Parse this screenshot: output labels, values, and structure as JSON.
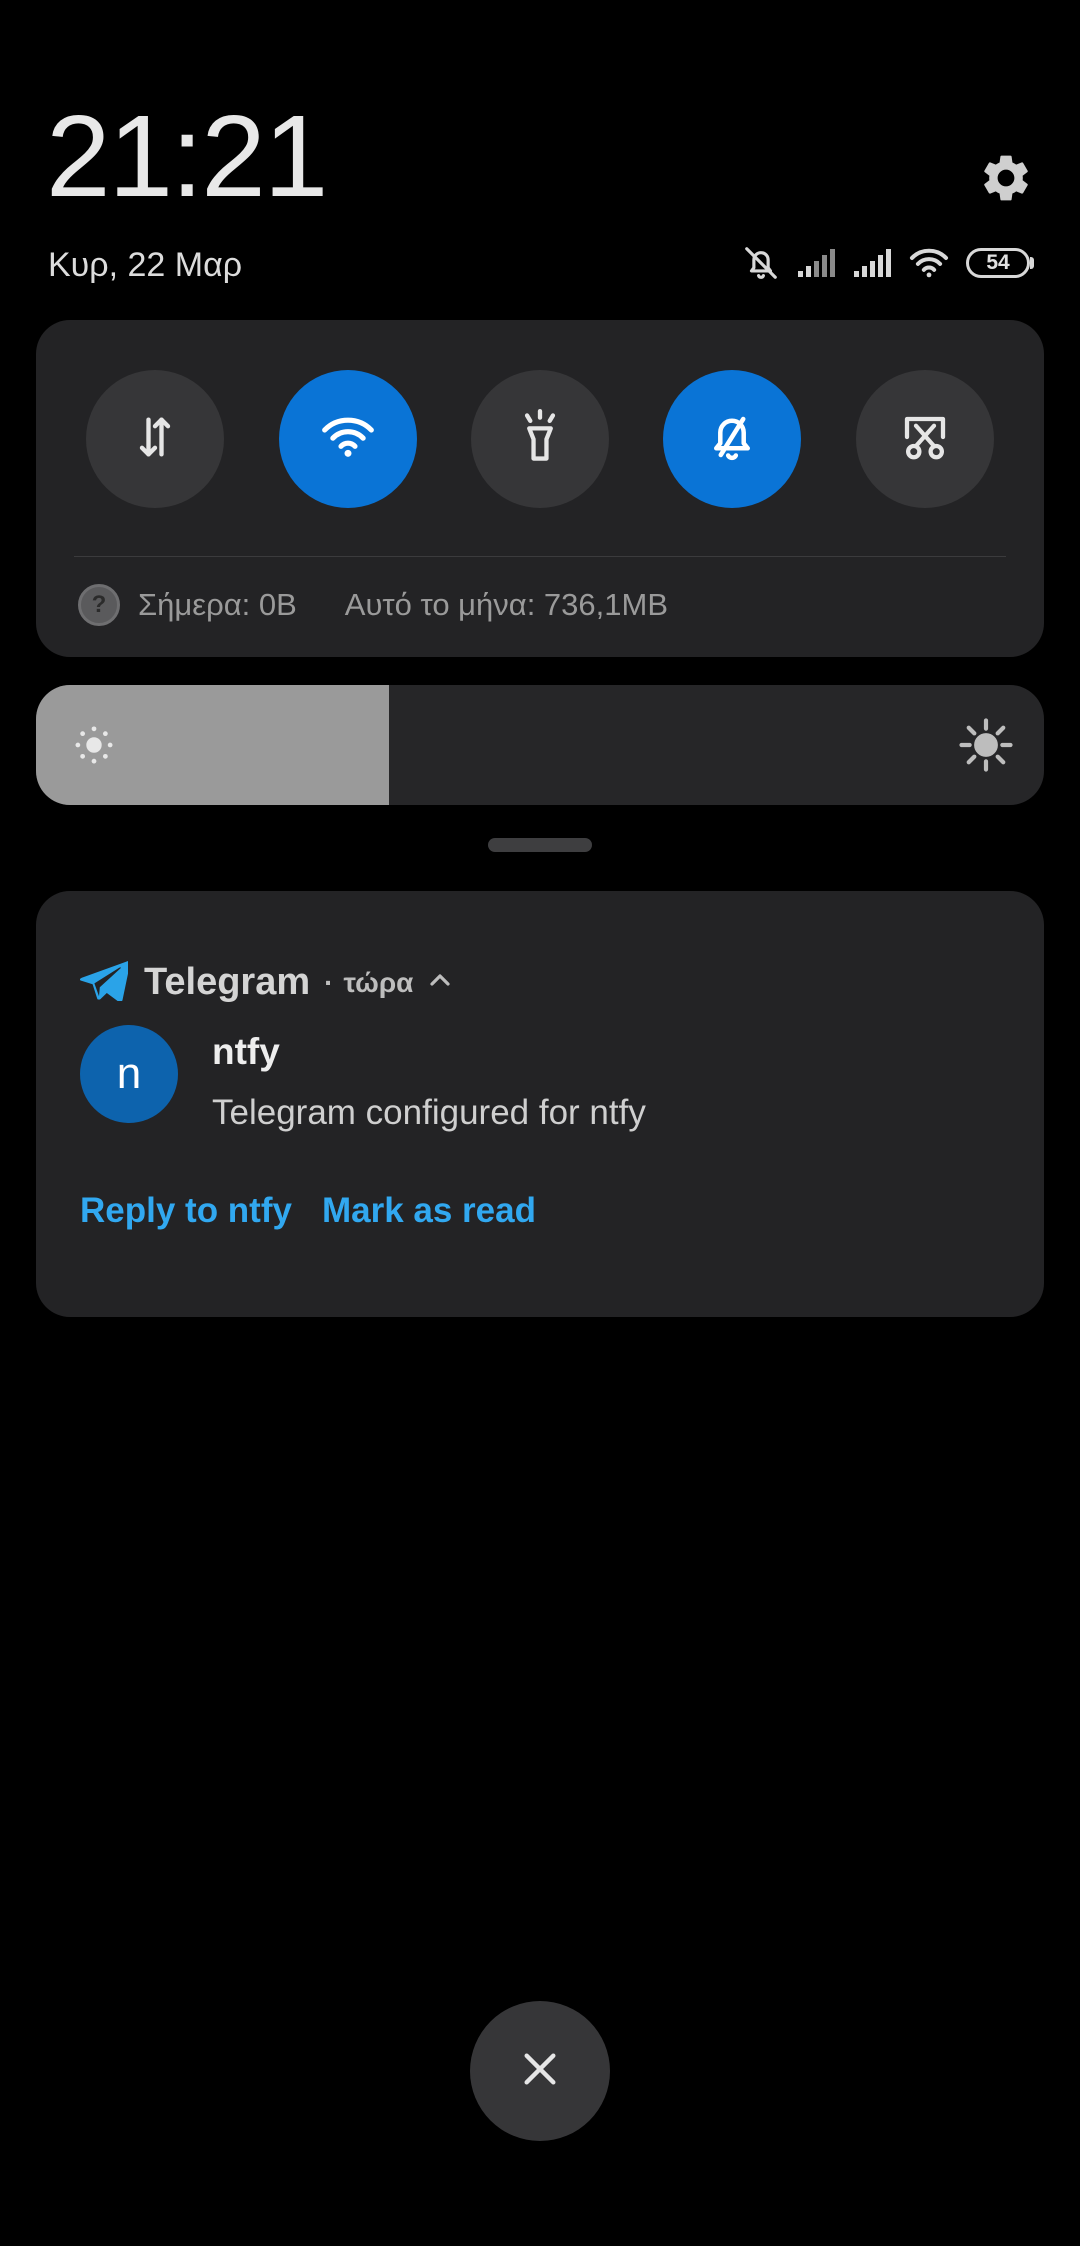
{
  "header": {
    "time": "21:21",
    "date": "Κυρ, 22 Μαρ",
    "battery_level": "54"
  },
  "quick_settings": {
    "toggles": [
      {
        "name": "mobile-data",
        "icon": "data-arrows-icon",
        "active": false
      },
      {
        "name": "wifi",
        "icon": "wifi-icon",
        "active": true
      },
      {
        "name": "flashlight",
        "icon": "flashlight-icon",
        "active": false
      },
      {
        "name": "silent",
        "icon": "bell-off-icon",
        "active": true
      },
      {
        "name": "screenshot",
        "icon": "scissors-icon",
        "active": false
      }
    ],
    "data_usage": {
      "today": "Σήμερα: 0B",
      "month": "Αυτό το μήνα: 736,1MB"
    }
  },
  "brightness": {
    "level": 0.35
  },
  "notification": {
    "app": "Telegram",
    "time": "τώρα",
    "avatar_letter": "n",
    "title": "ntfy",
    "body": "Telegram configured for ntfy",
    "actions": [
      "Reply to ntfy",
      "Mark as read"
    ]
  },
  "colors": {
    "accent_blue": "#0a74d6",
    "action_text": "#31a8f0",
    "avatar_bg": "#0d63ad",
    "panel_bg": "#232325",
    "toggle_off": "#363638"
  }
}
